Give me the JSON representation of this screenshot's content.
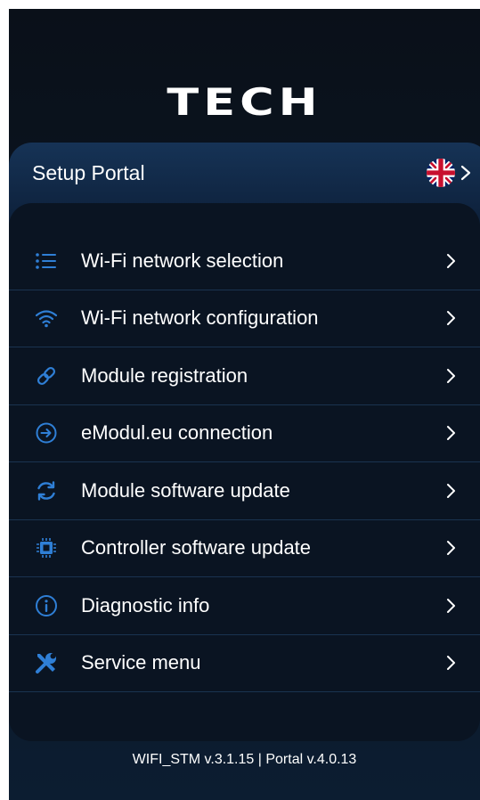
{
  "brand": {
    "logo_text": "TECH"
  },
  "header": {
    "title": "Setup Portal",
    "language_icon": "uk-flag-icon"
  },
  "menu": {
    "items": [
      {
        "label": "Wi-Fi network selection",
        "icon": "list-icon"
      },
      {
        "label": "Wi-Fi network configuration",
        "icon": "wifi-icon"
      },
      {
        "label": "Module registration",
        "icon": "link-icon"
      },
      {
        "label": "eModul.eu connection",
        "icon": "arrow-circle-icon"
      },
      {
        "label": "Module software update",
        "icon": "refresh-icon"
      },
      {
        "label": "Controller software update",
        "icon": "chip-icon"
      },
      {
        "label": "Diagnostic info",
        "icon": "info-icon"
      },
      {
        "label": "Service menu",
        "icon": "tools-icon"
      }
    ]
  },
  "footer": {
    "version_text": "WIFI_STM v.3.1.15 | Portal v.4.0.13"
  },
  "colors": {
    "background": "#0b1522",
    "card": "#0a1422",
    "accent": "#2f7fd6",
    "divider": "#1a3350",
    "text": "#ffffff"
  }
}
